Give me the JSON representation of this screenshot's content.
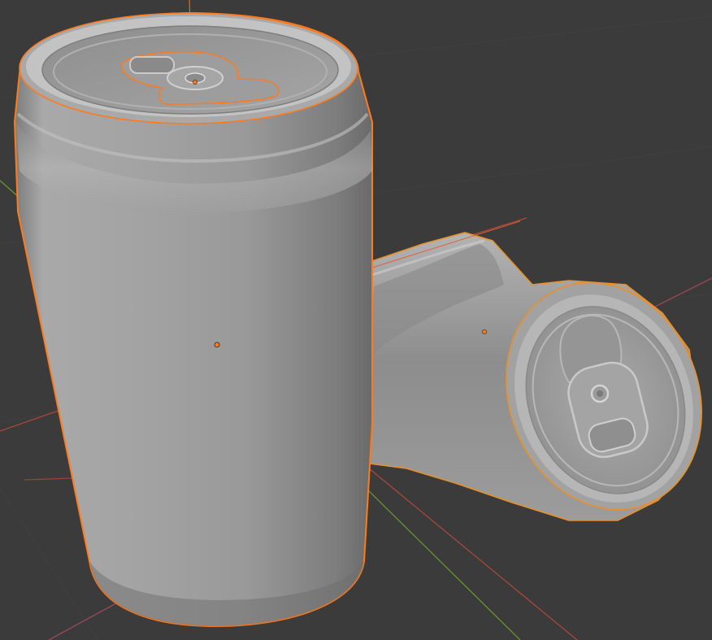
{
  "viewport": {
    "background_color": "#3b3b3b",
    "grid_line_color": "#434343"
  },
  "axes": {
    "x_axis_color": "#b0483a",
    "y_axis_color": "#6f9a2e",
    "z_axis_color": "#a8485e"
  },
  "selection": {
    "active_outline_color": "#ff7a1c",
    "selected_outline_color": "#e8902a",
    "origin_dot_color": "#ff7a1c"
  },
  "objects": [
    {
      "id": "can-upright",
      "selected": true,
      "active": true,
      "material_color": "#9a9a9a"
    },
    {
      "id": "can-crushed",
      "selected": true,
      "active": false,
      "material_color": "#9a9a9a"
    }
  ]
}
